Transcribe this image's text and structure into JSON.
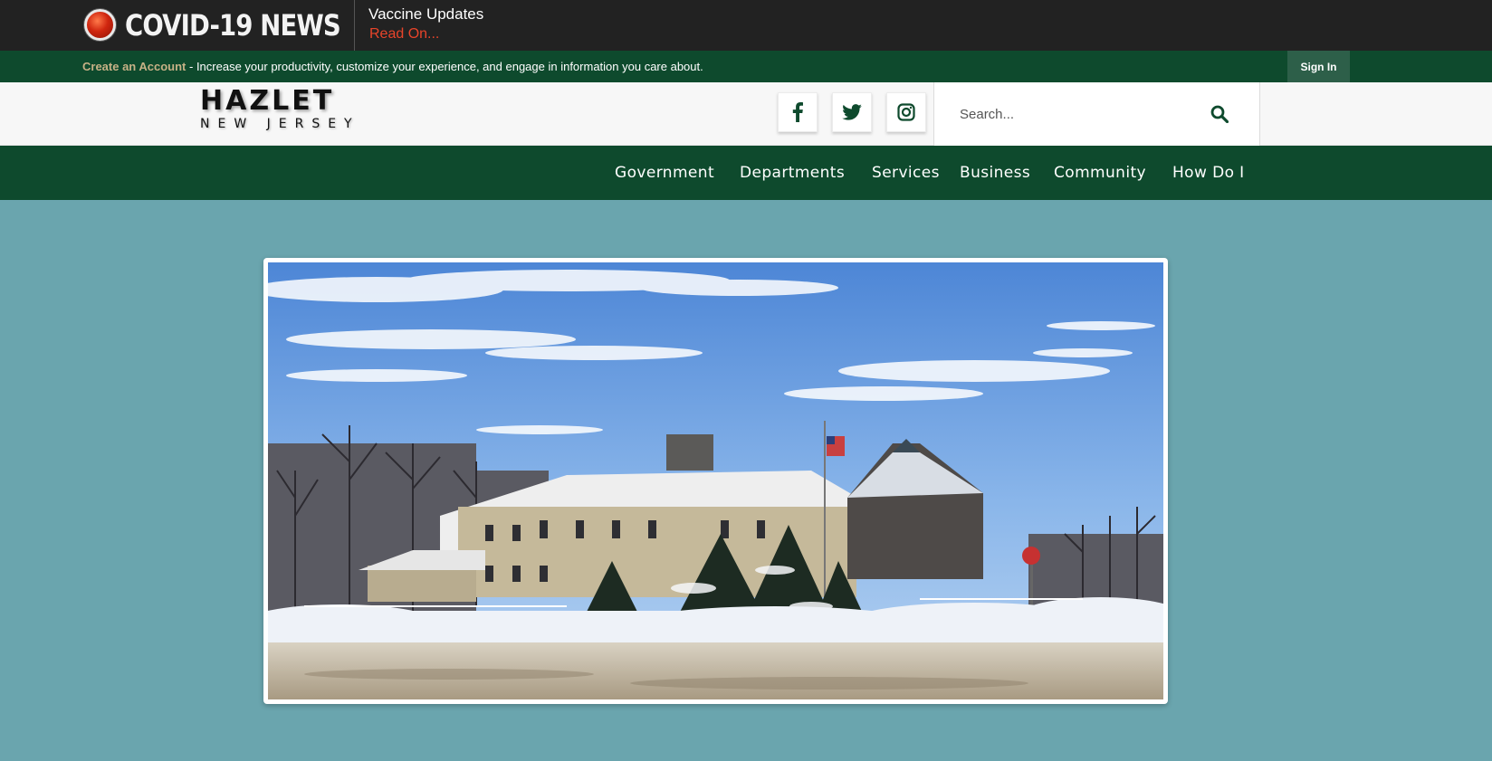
{
  "covid_banner": {
    "title": "COVID-19 NEWS",
    "headline": "Vaccine Updates",
    "link_label": "Read On..."
  },
  "account_bar": {
    "create_link": "Create an Account",
    "message": " - Increase your productivity, customize your experience, and engage in information you care about.",
    "signin_label": "Sign In"
  },
  "header": {
    "logo_main": "HAZLET",
    "logo_sub": "NEW JERSEY",
    "social": [
      "facebook-icon",
      "twitter-icon",
      "instagram-icon"
    ],
    "search_placeholder": "Search..."
  },
  "nav": {
    "items": [
      "Government",
      "Departments",
      "Services",
      "Business",
      "Community",
      "How Do I"
    ]
  },
  "colors": {
    "topbar": "#222222",
    "green": "#0e4a2d",
    "accent_link": "#c7b186",
    "alert_red": "#e8442a",
    "page_bg": "#6aa5ae"
  }
}
